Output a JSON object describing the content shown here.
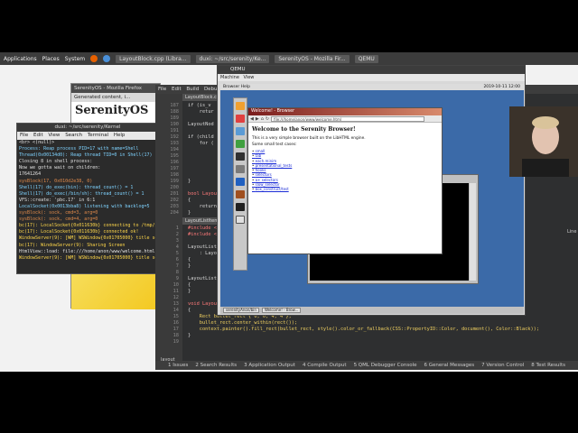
{
  "panel": {
    "applications": "Applications",
    "places": "Places",
    "system": "System",
    "tasks": [
      "LayoutBlock.cpp (Libra...",
      "duxi: ~/src/serenity/Ke...",
      "SerenityOS - Mozilla Fir...",
      "QEMU"
    ]
  },
  "firefox": {
    "title": "SerenityOS - Mozilla Firefox",
    "tab": "Generated content, i...",
    "heading": "SerenityOS"
  },
  "terminal": {
    "title": "duxi: ~/src/serenity/Kernel",
    "menu": [
      "File",
      "Edit",
      "View",
      "Search",
      "Terminal",
      "Help"
    ],
    "lines": [
      {
        "text": "<br> <(null)>",
        "color": "#e0e0e0"
      },
      {
        "text": "Process: Reap process PID=17 with name=Shell",
        "color": "#7fd3ff"
      },
      {
        "text": "Thread(0x00134d0): Reap thread TID=0 in Shell(17)",
        "color": "#7fd3ff"
      },
      {
        "text": "Closing 8 in shell process:",
        "color": "#e0e0e0"
      },
      {
        "text": "Now we gotta wait on children:",
        "color": "#e0e0e0"
      },
      {
        "text": "  17641264",
        "color": "#e0e0e0"
      },
      {
        "text": "sysBlock(17, 0x010d2e38, 0)",
        "color": "#e08a4a"
      },
      {
        "text": "Shell(17) do_exec(bin): thread_count() = 1",
        "color": "#7fd3ff"
      },
      {
        "text": "Shell(17) do_exec(/bin/sh): thread_count() = 1",
        "color": "#7fd3ff"
      },
      {
        "text": "VFS::create: 'pbc.17' in 6:1",
        "color": "#e0e0e0"
      },
      {
        "text": "LocalSocket(0x0013bba8) listening with backlog=5",
        "color": "#7fd3ff"
      },
      {
        "text": "sysBlock(: sock, cmd=3, arg=0",
        "color": "#e08a4a"
      },
      {
        "text": "sysBlock(: sock, cmd=4, arg=0",
        "color": "#e08a4a"
      },
      {
        "text": "bc(17): LocalSocket{0x011630b} connecting to /tmp/p",
        "color": "#ffd74a"
      },
      {
        "text": "bc(17): LocalSocket{0x011630b} connected ok!",
        "color": "#ffd74a"
      },
      {
        "text": "WindowServer(9): [WM] WSWindow{0x01705000} title se",
        "color": "#ffd74a"
      },
      {
        "text": "bc(17): WindowServer(9): Sharing Screen",
        "color": "#ffd74a"
      },
      {
        "text": "HtmlView::load: file:///home/anon/www/welcome.html",
        "color": "#e0e0e0"
      },
      {
        "text": "WindowServer(9): [WM] WSWindow{0x01705000} title se",
        "color": "#ffd74a"
      }
    ]
  },
  "qtcreator": {
    "menu": [
      "File",
      "Edit",
      "Build",
      "Debug"
    ],
    "file_tab_top": "LayoutBlock.cpp (Lib",
    "file_tab_bottom": "LayoutListItem.cpp",
    "line_numbers_top": [
      "187",
      "188",
      "189",
      "190",
      "191",
      "192",
      "193",
      "194",
      "195",
      "196",
      "197",
      "198",
      "199",
      "200",
      "201",
      "202",
      "203",
      "204"
    ],
    "code_top": [
      "if (is_v",
      "    retur",
      "",
      "LayoutNod",
      "",
      "if (child",
      "    for (",
      "",
      "",
      "",
      "",
      "",
      "}",
      "",
      "bool LayoutBl",
      "{",
      "    return fi",
      "}"
    ],
    "line_numbers_bottom": [
      "1",
      "2",
      "3",
      "4",
      "5",
      "6",
      "7",
      "8",
      "9",
      "10",
      "11",
      "12",
      "13",
      "14",
      "15",
      "16",
      "17",
      "18",
      "19"
    ],
    "code_bottom": [
      "#include <LibH",
      "#include <LibH",
      "",
      "LayoutListItem",
      "    : LayoutNo",
      "{",
      "}",
      "",
      "LayoutListItem",
      "{",
      "}",
      "",
      "void LayoutListItem::render(RenderingContext& context)",
      "{",
      "    Rect bullet_rect { 0, 0, 4, 4 };",
      "    bullet_rect.center_within(rect());",
      "    context.painter().fill_rect(bullet_rect, style().color_or_fallback(CSS::PropertyID::Color, document(), Color::Black));",
      "}",
      ""
    ],
    "right_label": "Line",
    "status_items": [
      "1 Issues",
      "2 Search Results",
      "3 Application Output",
      "4 Compile Output",
      "5 QML Debugger Console",
      "6 General Messages",
      "7 Version Control",
      "8 Test Results"
    ],
    "bottom_left": "layout"
  },
  "qemu": {
    "title": "QEMU",
    "menu": [
      "Machine",
      "View"
    ],
    "serenity_menubar": "Browser   Help",
    "clock": "2019-10-11 12:00"
  },
  "browser": {
    "title": "Welcome! - Browser",
    "url": "file:///home/anon/www/welcome.html",
    "heading": "Welcome to the Serenity Browser!",
    "intro": "This is a very simple browser built on the LibHTML engine.",
    "sub": "Some small test cases:",
    "links": [
      "small",
      "tab",
      "each.minim",
      "presentational_tests",
      "hooks",
      "selectors",
      "a+ selectors",
      "slow_selector",
      "box_construct/test"
    ]
  },
  "serenity_taskbar": {
    "items": [
      "serenityAnon/bin",
      "Welcome! - Brow..."
    ]
  },
  "colors": {
    "qemu_desktop": "#3b6aa8",
    "browser_title_left": "#7a1d1d",
    "browser_title_right": "#d88a6c",
    "link": "#1a2bd6"
  }
}
